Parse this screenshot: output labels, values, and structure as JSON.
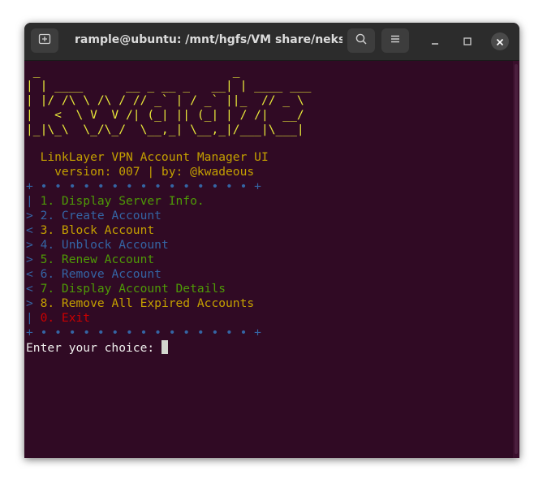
{
  "window": {
    "title": "rample@ubuntu: /mnt/hgfs/VM share/neksg"
  },
  "icons": {
    "new_tab": "new-tab-icon",
    "search": "search-icon",
    "menu": "hamburger-menu-icon",
    "minimize": "minimize-icon",
    "maximize": "maximize-icon",
    "close": "close-icon"
  },
  "colors": {
    "terminal_bg": "#300a24",
    "titlebar_bg": "#2c2c2c",
    "cyan": "#2bb6c8",
    "yellow": "#c4a000",
    "green": "#4e9a06",
    "blue": "#3465a4",
    "red": "#cc0000"
  },
  "terminal": {
    "logo": [
      " _                           _",
      "| | ____      __ _ __ _   __| | ____ ___",
      "| |/ /\\ \\ /\\ / // _` | / _` ||_  // _ \\",
      "|   <  \\ V  V /| (_| || (_| | / /|  __/",
      "|_|\\_\\  \\_/\\_/  \\__,_| \\__,_|/___|\\___|"
    ],
    "app_name": "  LinkLayer VPN Account Manager UI",
    "version_line": "    version: 007 | by: @kwadeous",
    "separator_top": "+ • • • • • • • • • • • • • • • +",
    "menu": [
      {
        "prefix": "| ",
        "label": "1. Display Server Info.",
        "color": "green"
      },
      {
        "prefix": "> ",
        "label": "2. Create Account",
        "color": "blue"
      },
      {
        "prefix": "< ",
        "label": "3. Block Account",
        "color": "yellow"
      },
      {
        "prefix": "> ",
        "label": "4. Unblock Account",
        "color": "blue"
      },
      {
        "prefix": "> ",
        "label": "5. Renew Account",
        "color": "green"
      },
      {
        "prefix": "< ",
        "label": "6. Remove Account",
        "color": "blue"
      },
      {
        "prefix": "< ",
        "label": "7. Display Account Details",
        "color": "green"
      },
      {
        "prefix": "> ",
        "label": "8. Remove All Expired Accounts",
        "color": "yellow"
      },
      {
        "prefix": "| ",
        "label": "0. Exit",
        "color": "red"
      }
    ],
    "separator_bottom": "+ • • • • • • • • • • • • • • • +",
    "prompt": "Enter your choice: "
  }
}
